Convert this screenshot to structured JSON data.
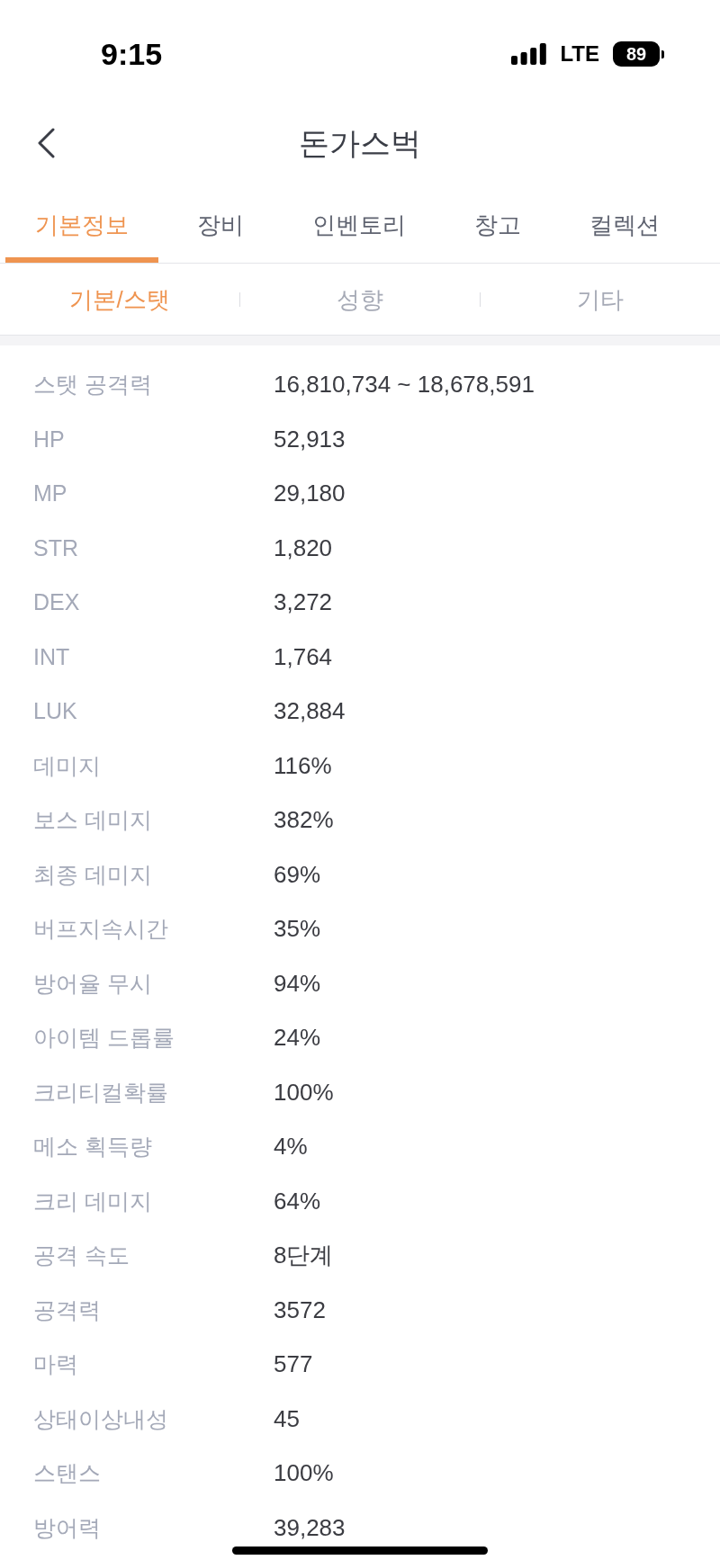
{
  "status_bar": {
    "time": "9:15",
    "network": "LTE",
    "battery": "89"
  },
  "header": {
    "title": "돈가스벅"
  },
  "tabs": [
    {
      "label": "기본정보",
      "selected": true
    },
    {
      "label": "장비",
      "selected": false
    },
    {
      "label": "인벤토리",
      "selected": false
    },
    {
      "label": "창고",
      "selected": false
    },
    {
      "label": "컬렉션",
      "selected": false
    }
  ],
  "sub_tabs": [
    {
      "label": "기본/스탯",
      "selected": true
    },
    {
      "label": "성향",
      "selected": false
    },
    {
      "label": "기타",
      "selected": false
    }
  ],
  "stats": [
    {
      "label": "스탯 공격력",
      "value": "16,810,734 ~ 18,678,591"
    },
    {
      "label": "HP",
      "value": "52,913"
    },
    {
      "label": "MP",
      "value": "29,180"
    },
    {
      "label": "STR",
      "value": "1,820"
    },
    {
      "label": "DEX",
      "value": "3,272"
    },
    {
      "label": "INT",
      "value": "1,764"
    },
    {
      "label": "LUK",
      "value": "32,884"
    },
    {
      "label": "데미지",
      "value": "116%"
    },
    {
      "label": "보스 데미지",
      "value": "382%"
    },
    {
      "label": "최종 데미지",
      "value": "69%"
    },
    {
      "label": "버프지속시간",
      "value": "35%"
    },
    {
      "label": "방어율 무시",
      "value": "94%"
    },
    {
      "label": "아이템 드롭률",
      "value": "24%"
    },
    {
      "label": "크리티컬확률",
      "value": "100%"
    },
    {
      "label": "메소 획득량",
      "value": "4%"
    },
    {
      "label": "크리 데미지",
      "value": "64%"
    },
    {
      "label": "공격 속도",
      "value": "8단계"
    },
    {
      "label": "공격력",
      "value": "3572"
    },
    {
      "label": "마력",
      "value": "577"
    },
    {
      "label": "상태이상내성",
      "value": "45"
    },
    {
      "label": "스탠스",
      "value": "100%"
    },
    {
      "label": "방어력",
      "value": "39,283"
    }
  ]
}
